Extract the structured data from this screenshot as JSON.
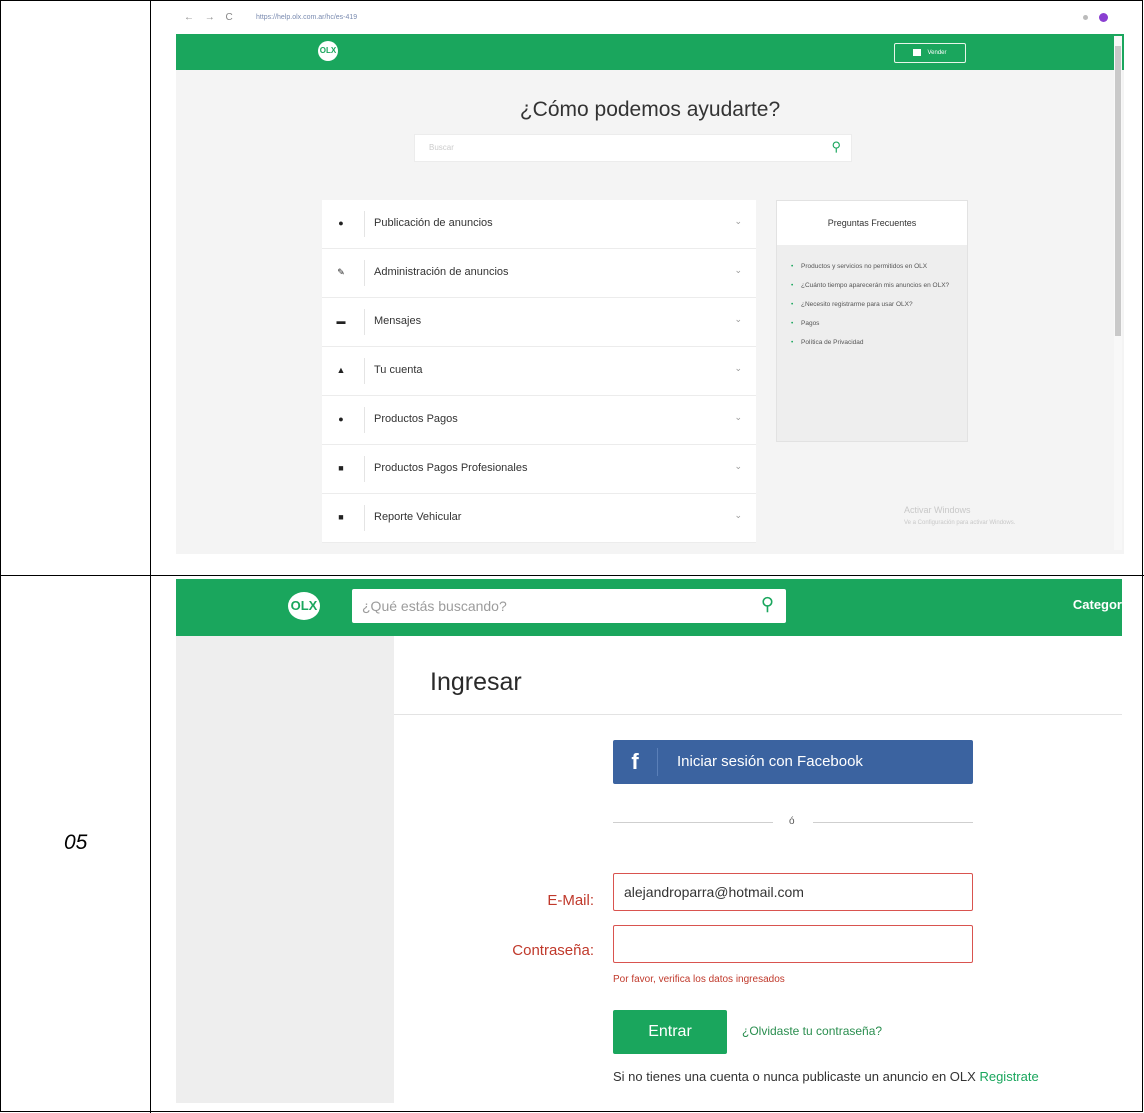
{
  "row_label": "05",
  "help_page": {
    "browser": {
      "nav_glyphs": "← → C",
      "url": "https://help.olx.com.ar/hc/es-419"
    },
    "header": {
      "logo": "OLX",
      "vender_label": "Vender"
    },
    "title": "¿Cómo podemos ayudarte?",
    "search_placeholder": "Buscar",
    "topics": [
      {
        "icon": "tag-icon",
        "glyph": "●",
        "label": "Publicación de anuncios"
      },
      {
        "icon": "edit-icon",
        "glyph": "✎",
        "label": "Administración de anuncios"
      },
      {
        "icon": "chat-icon",
        "glyph": "▬",
        "label": "Mensajes"
      },
      {
        "icon": "user-icon",
        "glyph": "▲",
        "label": "Tu cuenta"
      },
      {
        "icon": "coin-icon",
        "glyph": "●",
        "label": "Productos Pagos"
      },
      {
        "icon": "briefcase-icon",
        "glyph": "■",
        "label": "Productos Pagos Profesionales"
      },
      {
        "icon": "report-icon",
        "glyph": "■",
        "label": "Reporte Vehicular"
      }
    ],
    "faq": {
      "title": "Preguntas Frecuentes",
      "items": [
        "Productos y servicios no permitidos en OLX",
        "¿Cuánto tiempo aparecerán mis anuncios en OLX?",
        "¿Necesito registrarme para usar OLX?",
        "Pagos",
        "Política de Privacidad"
      ]
    },
    "watermark": {
      "title": "Activar Windows",
      "subtitle": "Ve a Configuración para activar Windows."
    }
  },
  "login_page": {
    "header": {
      "logo": "OLX",
      "search_placeholder": "¿Qué estás buscando?",
      "categories": "Categor"
    },
    "title": "Ingresar",
    "facebook_button": "Iniciar sesión con Facebook",
    "facebook_glyph": "f",
    "or_text": "ó",
    "email_label": "E-Mail:",
    "email_value": "alejandroparra@hotmail.com",
    "password_label": "Contraseña:",
    "password_value": "",
    "error_message": "Por favor, verifica los datos ingresados",
    "submit_button": "Entrar",
    "forgot_link": "¿Olvidaste tu contraseña?",
    "signup_text": "Si no tienes una cuenta o nunca publicaste un anuncio en OLX",
    "signup_link": "Registrate",
    "colors": {
      "brand_green": "#1aa65d",
      "facebook_blue": "#3b63a0",
      "error_red": "#c0392b"
    }
  }
}
